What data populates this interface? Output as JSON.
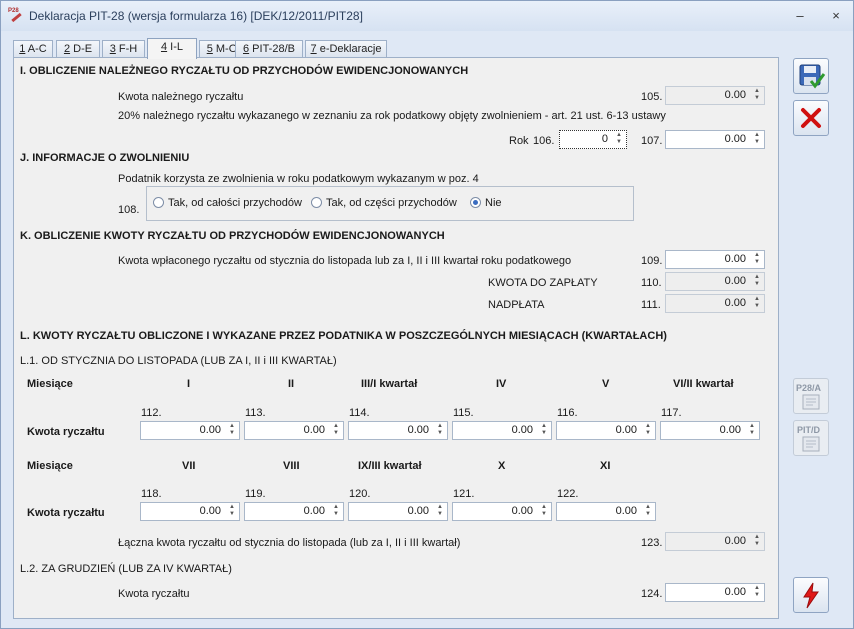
{
  "window": {
    "title": "Deklaracja PIT-28 (wersja formularza 16) [DEK/12/2011/PIT28]",
    "icon_text": "P28",
    "minimize_icon": "minimize-icon",
    "close_icon": "close-icon",
    "minimize_glyph": "–",
    "close_glyph": "×"
  },
  "tabs": [
    {
      "key": "1",
      "rest": " A-C"
    },
    {
      "key": "2",
      "rest": " D-E"
    },
    {
      "key": "3",
      "rest": " F-H"
    },
    {
      "key": "4",
      "rest": " I-L"
    },
    {
      "key": "5",
      "rest": " M-O"
    },
    {
      "key": "6",
      "rest": " PIT-28/B"
    },
    {
      "key": "7",
      "rest": " e-Deklaracje"
    }
  ],
  "active_tab": "4 I-L",
  "sectionI": {
    "title": "I. OBLICZENIE NALEŻNEGO RYCZAŁTU OD PRZYCHODÓW EWIDENCJONOWANYCH",
    "kwota_label": "Kwota należnego ryczałtu",
    "pos105": "105.",
    "val105": "0.00",
    "info": "20% należnego ryczałtu wykazanego w zeznaniu za rok podatkowy objęty zwolnieniem - art. 21 ust. 6-13 ustawy",
    "rok_label": "Rok",
    "pos106": "106.",
    "val106": "0",
    "pos107": "107.",
    "val107": "0.00"
  },
  "sectionJ": {
    "title": "J. INFORMACJE O ZWOLNIENIU",
    "info": "Podatnik korzysta ze zwolnienia w roku podatkowym wykazanym w poz. 4",
    "pos108": "108.",
    "options": [
      "Tak, od całości przychodów",
      "Tak, od części przychodów",
      "Nie"
    ],
    "selected": "Nie"
  },
  "sectionK": {
    "title": "K. OBLICZENIE KWOTY RYCZAŁTU OD PRZYCHODÓW EWIDENCJONOWANYCH",
    "info": "Kwota wpłaconego ryczałtu od stycznia do listopada lub za I, II i III kwartał roku podatkowego",
    "pos109": "109.",
    "val109": "0.00",
    "kwota_label": "KWOTA DO ZAPŁATY",
    "pos110": "110.",
    "val110": "0.00",
    "nadplata_label": "NADPŁATA",
    "pos111": "111.",
    "val111": "0.00"
  },
  "sectionL": {
    "title": "L. KWOTY RYCZAŁTU OBLICZONE I WYKAZANE PRZEZ PODATNIKA W POSZCZEGÓLNYCH MIESIĄCACH  (KWARTAŁACH)",
    "sub1": "L.1. OD STYCZNIA DO LISTOPADA (LUB ZA I, II i III KWARTAŁ)",
    "miesiace": "Miesiące",
    "kwota": "Kwota ryczałtu",
    "row1_headers": [
      "I",
      "II",
      "III/I kwartał",
      "IV",
      "V",
      "VI/II kwartał"
    ],
    "row1_positions": [
      "112.",
      "113.",
      "114.",
      "115.",
      "116.",
      "117."
    ],
    "row1_values": [
      "0.00",
      "0.00",
      "0.00",
      "0.00",
      "0.00",
      "0.00"
    ],
    "row2_headers": [
      "VII",
      "VIII",
      "IX/III kwartał",
      "X",
      "XI"
    ],
    "row2_positions": [
      "118.",
      "119.",
      "120.",
      "121.",
      "122."
    ],
    "row2_values": [
      "0.00",
      "0.00",
      "0.00",
      "0.00",
      "0.00"
    ],
    "total_label": "Łączna kwota ryczałtu od stycznia do listopada (lub za I, II i III kwartał)",
    "pos123": "123.",
    "val123": "0.00",
    "sub2": "L.2. ZA GRUDZIEŃ (LUB ZA IV KWARTAŁ)",
    "kwota2": "Kwota ryczałtu",
    "pos124": "124.",
    "val124": "0.00"
  },
  "side_buttons": {
    "save_icon": "save-icon",
    "cancel_icon": "cancel-icon",
    "p28a_label": "P28/A",
    "pitd_label": "PIT/D",
    "execute_icon": "lightning-icon"
  },
  "colors": {
    "window_bg": "#dfe8f5",
    "panel_bg": "#f0f0f0",
    "readonly_field": "#eeeeee",
    "cancel_red": "#d01010"
  }
}
